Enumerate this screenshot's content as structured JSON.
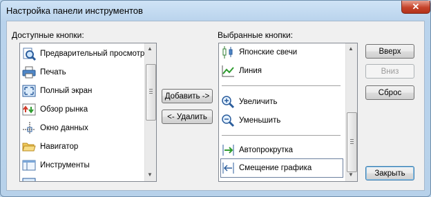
{
  "window": {
    "title": "Настройка панели инструментов",
    "close_glyph": "✕"
  },
  "available": {
    "label": "Доступные кнопки:",
    "items": [
      {
        "label": "Предварительный просмотр",
        "icon": "print-preview-icon"
      },
      {
        "label": "Печать",
        "icon": "printer-icon"
      },
      {
        "label": "Полный экран",
        "icon": "full-screen-icon"
      },
      {
        "label": "Обзор рынка",
        "icon": "market-watch-icon"
      },
      {
        "label": "Окно данных",
        "icon": "data-window-icon"
      },
      {
        "label": "Навигатор",
        "icon": "navigator-folder-icon"
      },
      {
        "label": "Инструменты",
        "icon": "toolbox-icon"
      }
    ]
  },
  "selected": {
    "label": "Выбранные кнопки:",
    "items": [
      {
        "label": "Японские свечи",
        "icon": "candlesticks-icon"
      },
      {
        "label": "Линия",
        "icon": "line-chart-icon"
      },
      {
        "label": "Увеличить",
        "icon": "zoom-in-icon"
      },
      {
        "label": "Уменьшить",
        "icon": "zoom-out-icon"
      },
      {
        "label": "Автопрокрутка",
        "icon": "autoscroll-icon"
      },
      {
        "label": "Смещение графика",
        "icon": "chart-shift-icon"
      }
    ]
  },
  "buttons": {
    "add": "Добавить ->",
    "remove": "<- Удалить",
    "up": "Вверх",
    "down": "Вниз",
    "reset": "Сброс",
    "close": "Закрыть"
  },
  "colors": {
    "accent": "#3c7fb1",
    "title_bar": "#bcd6ee",
    "close": "#c5432a"
  }
}
